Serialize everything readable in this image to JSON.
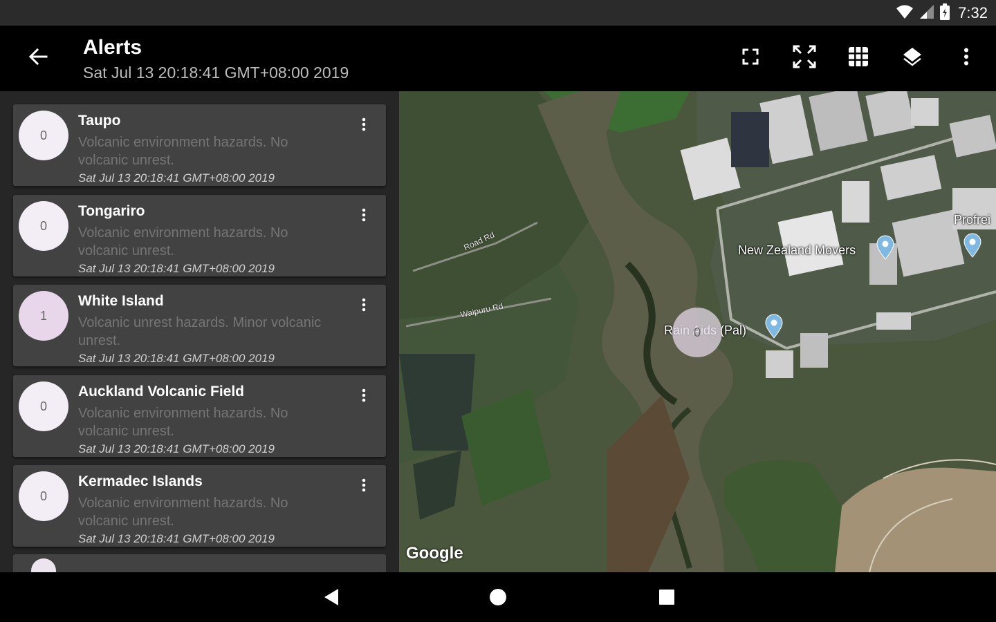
{
  "status_bar": {
    "time": "7:32",
    "icons": [
      "wifi-icon",
      "cell-signal-icon",
      "battery-icon"
    ]
  },
  "app_bar": {
    "title": "Alerts",
    "subtitle": "Sat Jul 13 20:18:41 GMT+08:00 2019",
    "back_icon": "arrow-back-icon",
    "actions": [
      "fullscreen-icon",
      "zoom-fit-icon",
      "grid-icon",
      "layers-icon",
      "more-vert-icon"
    ]
  },
  "alerts": [
    {
      "level": "0",
      "name": "Taupo",
      "description": "Volcanic environment hazards. No volcanic unrest.",
      "date": "Sat Jul 13 20:18:41 GMT+08:00 2019"
    },
    {
      "level": "0",
      "name": "Tongariro",
      "description": "Volcanic environment hazards. No volcanic unrest.",
      "date": "Sat Jul 13 20:18:41 GMT+08:00 2019"
    },
    {
      "level": "1",
      "name": "White Island",
      "description": "Volcanic unrest hazards. Minor volcanic unrest.",
      "date": "Sat Jul 13 20:18:41 GMT+08:00 2019"
    },
    {
      "level": "0",
      "name": "Auckland Volcanic Field",
      "description": "Volcanic environment hazards. No volcanic unrest.",
      "date": "Sat Jul 13 20:18:41 GMT+08:00 2019"
    },
    {
      "level": "0",
      "name": "Kermadec Islands",
      "description": "Volcanic environment hazards. No volcanic unrest.",
      "date": "Sat Jul 13 20:18:41 GMT+08:00 2019"
    }
  ],
  "colors": {
    "level_0": "#f3eef5",
    "level_1": "#e8d6ea",
    "card_bg": "#424242",
    "panel_bg": "#262626"
  },
  "map": {
    "labels": {
      "new_zealand_movers": "New Zealand Movers",
      "profrei": "Profrei",
      "rain_aids": "Rain Aids (Pal)",
      "road_rd": "Road Rd",
      "waipuru_rd": "Waipuru Rd",
      "google": "Google"
    },
    "cluster_count": "0"
  },
  "nav_bar": {
    "buttons": [
      "nav-back-icon",
      "nav-home-icon",
      "nav-recents-icon"
    ]
  }
}
